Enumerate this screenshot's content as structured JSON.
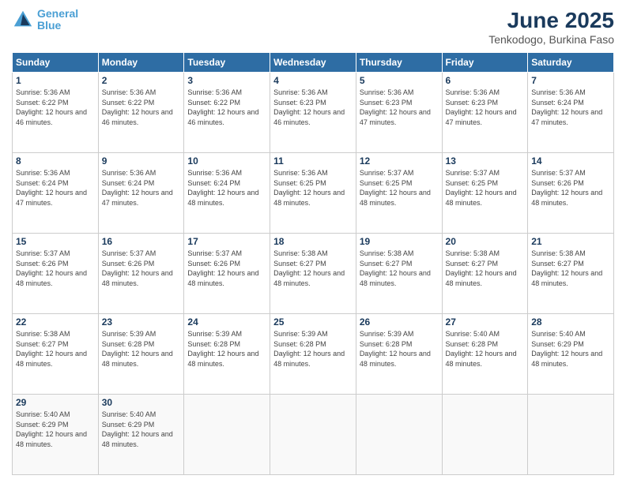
{
  "header": {
    "logo": {
      "line1": "General",
      "line2": "Blue"
    },
    "title": "June 2025",
    "subtitle": "Tenkodogo, Burkina Faso"
  },
  "days_of_week": [
    "Sunday",
    "Monday",
    "Tuesday",
    "Wednesday",
    "Thursday",
    "Friday",
    "Saturday"
  ],
  "weeks": [
    [
      {
        "num": "1",
        "sunrise": "5:36 AM",
        "sunset": "6:22 PM",
        "daylight": "12 hours and 46 minutes."
      },
      {
        "num": "2",
        "sunrise": "5:36 AM",
        "sunset": "6:22 PM",
        "daylight": "12 hours and 46 minutes."
      },
      {
        "num": "3",
        "sunrise": "5:36 AM",
        "sunset": "6:22 PM",
        "daylight": "12 hours and 46 minutes."
      },
      {
        "num": "4",
        "sunrise": "5:36 AM",
        "sunset": "6:23 PM",
        "daylight": "12 hours and 46 minutes."
      },
      {
        "num": "5",
        "sunrise": "5:36 AM",
        "sunset": "6:23 PM",
        "daylight": "12 hours and 47 minutes."
      },
      {
        "num": "6",
        "sunrise": "5:36 AM",
        "sunset": "6:23 PM",
        "daylight": "12 hours and 47 minutes."
      },
      {
        "num": "7",
        "sunrise": "5:36 AM",
        "sunset": "6:24 PM",
        "daylight": "12 hours and 47 minutes."
      }
    ],
    [
      {
        "num": "8",
        "sunrise": "5:36 AM",
        "sunset": "6:24 PM",
        "daylight": "12 hours and 47 minutes."
      },
      {
        "num": "9",
        "sunrise": "5:36 AM",
        "sunset": "6:24 PM",
        "daylight": "12 hours and 47 minutes."
      },
      {
        "num": "10",
        "sunrise": "5:36 AM",
        "sunset": "6:24 PM",
        "daylight": "12 hours and 48 minutes."
      },
      {
        "num": "11",
        "sunrise": "5:36 AM",
        "sunset": "6:25 PM",
        "daylight": "12 hours and 48 minutes."
      },
      {
        "num": "12",
        "sunrise": "5:37 AM",
        "sunset": "6:25 PM",
        "daylight": "12 hours and 48 minutes."
      },
      {
        "num": "13",
        "sunrise": "5:37 AM",
        "sunset": "6:25 PM",
        "daylight": "12 hours and 48 minutes."
      },
      {
        "num": "14",
        "sunrise": "5:37 AM",
        "sunset": "6:26 PM",
        "daylight": "12 hours and 48 minutes."
      }
    ],
    [
      {
        "num": "15",
        "sunrise": "5:37 AM",
        "sunset": "6:26 PM",
        "daylight": "12 hours and 48 minutes."
      },
      {
        "num": "16",
        "sunrise": "5:37 AM",
        "sunset": "6:26 PM",
        "daylight": "12 hours and 48 minutes."
      },
      {
        "num": "17",
        "sunrise": "5:37 AM",
        "sunset": "6:26 PM",
        "daylight": "12 hours and 48 minutes."
      },
      {
        "num": "18",
        "sunrise": "5:38 AM",
        "sunset": "6:27 PM",
        "daylight": "12 hours and 48 minutes."
      },
      {
        "num": "19",
        "sunrise": "5:38 AM",
        "sunset": "6:27 PM",
        "daylight": "12 hours and 48 minutes."
      },
      {
        "num": "20",
        "sunrise": "5:38 AM",
        "sunset": "6:27 PM",
        "daylight": "12 hours and 48 minutes."
      },
      {
        "num": "21",
        "sunrise": "5:38 AM",
        "sunset": "6:27 PM",
        "daylight": "12 hours and 48 minutes."
      }
    ],
    [
      {
        "num": "22",
        "sunrise": "5:38 AM",
        "sunset": "6:27 PM",
        "daylight": "12 hours and 48 minutes."
      },
      {
        "num": "23",
        "sunrise": "5:39 AM",
        "sunset": "6:28 PM",
        "daylight": "12 hours and 48 minutes."
      },
      {
        "num": "24",
        "sunrise": "5:39 AM",
        "sunset": "6:28 PM",
        "daylight": "12 hours and 48 minutes."
      },
      {
        "num": "25",
        "sunrise": "5:39 AM",
        "sunset": "6:28 PM",
        "daylight": "12 hours and 48 minutes."
      },
      {
        "num": "26",
        "sunrise": "5:39 AM",
        "sunset": "6:28 PM",
        "daylight": "12 hours and 48 minutes."
      },
      {
        "num": "27",
        "sunrise": "5:40 AM",
        "sunset": "6:28 PM",
        "daylight": "12 hours and 48 minutes."
      },
      {
        "num": "28",
        "sunrise": "5:40 AM",
        "sunset": "6:29 PM",
        "daylight": "12 hours and 48 minutes."
      }
    ],
    [
      {
        "num": "29",
        "sunrise": "5:40 AM",
        "sunset": "6:29 PM",
        "daylight": "12 hours and 48 minutes."
      },
      {
        "num": "30",
        "sunrise": "5:40 AM",
        "sunset": "6:29 PM",
        "daylight": "12 hours and 48 minutes."
      },
      null,
      null,
      null,
      null,
      null
    ]
  ]
}
